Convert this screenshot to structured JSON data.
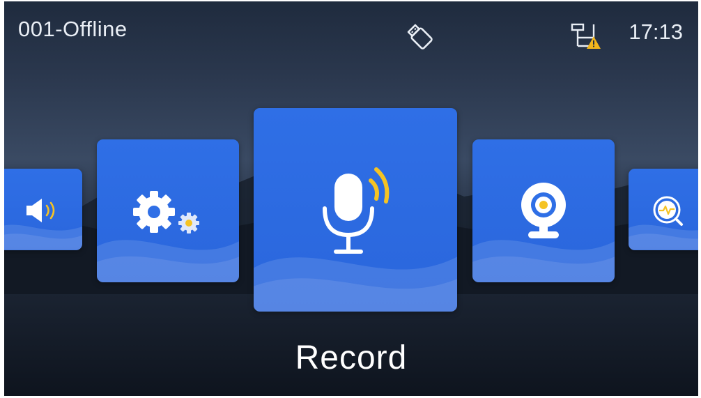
{
  "status_bar": {
    "device_status": "001-Offline",
    "time": "17:13",
    "icons": [
      "usb-icon",
      "network-warning-icon"
    ]
  },
  "carousel": {
    "items": [
      {
        "name": "volume",
        "icon": "speaker-icon"
      },
      {
        "name": "settings",
        "icon": "gears-icon"
      },
      {
        "name": "record",
        "icon": "microphone-icon",
        "selected": true
      },
      {
        "name": "camera",
        "icon": "webcam-icon"
      },
      {
        "name": "diagnostics",
        "icon": "heartbeat-search-icon"
      }
    ]
  },
  "caption": "Record",
  "colors": {
    "card_blue": "#2f6fe6",
    "accent_yellow": "#f5c324",
    "warning_yellow": "#f2b61c",
    "text": "#ffffff"
  }
}
